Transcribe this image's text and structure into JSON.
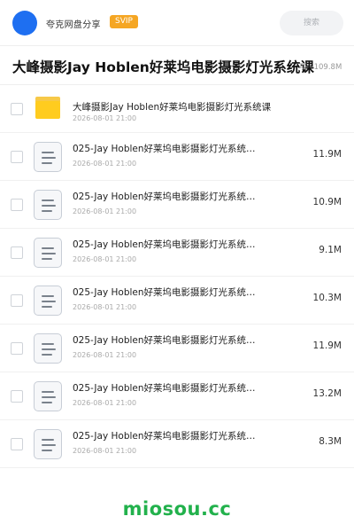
{
  "header": {
    "site_name": "夸克网盘分享",
    "vip_badge": "SVIP",
    "search_label": "搜索"
  },
  "title_bar": {
    "title": "大峰摄影Jay Hoblen好莱坞电影摄影灯光系统课",
    "meta": "项 · 109.8M"
  },
  "files": [
    {
      "type": "folder",
      "name": "大峰摄影Jay Hoblen好莱坞电影摄影灯光系统课",
      "date": "2026-08-01 21:00",
      "size": ""
    },
    {
      "type": "file",
      "name": "025-Jay Hoblen好莱坞电影摄影灯光系统…",
      "date": "2026-08-01 21:00",
      "size": "11.9M"
    },
    {
      "type": "file",
      "name": "025-Jay Hoblen好莱坞电影摄影灯光系统…",
      "date": "2026-08-01 21:00",
      "size": "10.9M"
    },
    {
      "type": "file",
      "name": "025-Jay Hoblen好莱坞电影摄影灯光系统…",
      "date": "2026-08-01 21:00",
      "size": "9.1M"
    },
    {
      "type": "file",
      "name": "025-Jay Hoblen好莱坞电影摄影灯光系统…",
      "date": "2026-08-01 21:00",
      "size": "10.3M"
    },
    {
      "type": "file",
      "name": "025-Jay Hoblen好莱坞电影摄影灯光系统…",
      "date": "2026-08-01 21:00",
      "size": "11.9M"
    },
    {
      "type": "file",
      "name": "025-Jay Hoblen好莱坞电影摄影灯光系统…",
      "date": "2026-08-01 21:00",
      "size": "13.2M"
    },
    {
      "type": "file",
      "name": "025-Jay Hoblen好莱坞电影摄影灯光系统…",
      "date": "2026-08-01 21:00",
      "size": "8.3M"
    }
  ],
  "watermark": "miosou.cc",
  "icons": {
    "avatar": "avatar-circle",
    "folder": "folder-icon",
    "file": "document-icon"
  },
  "colors": {
    "avatar": "#1e6ff1",
    "vip": "#f5a623",
    "folder": "#ffcc1f",
    "watermark": "#22b14c"
  }
}
